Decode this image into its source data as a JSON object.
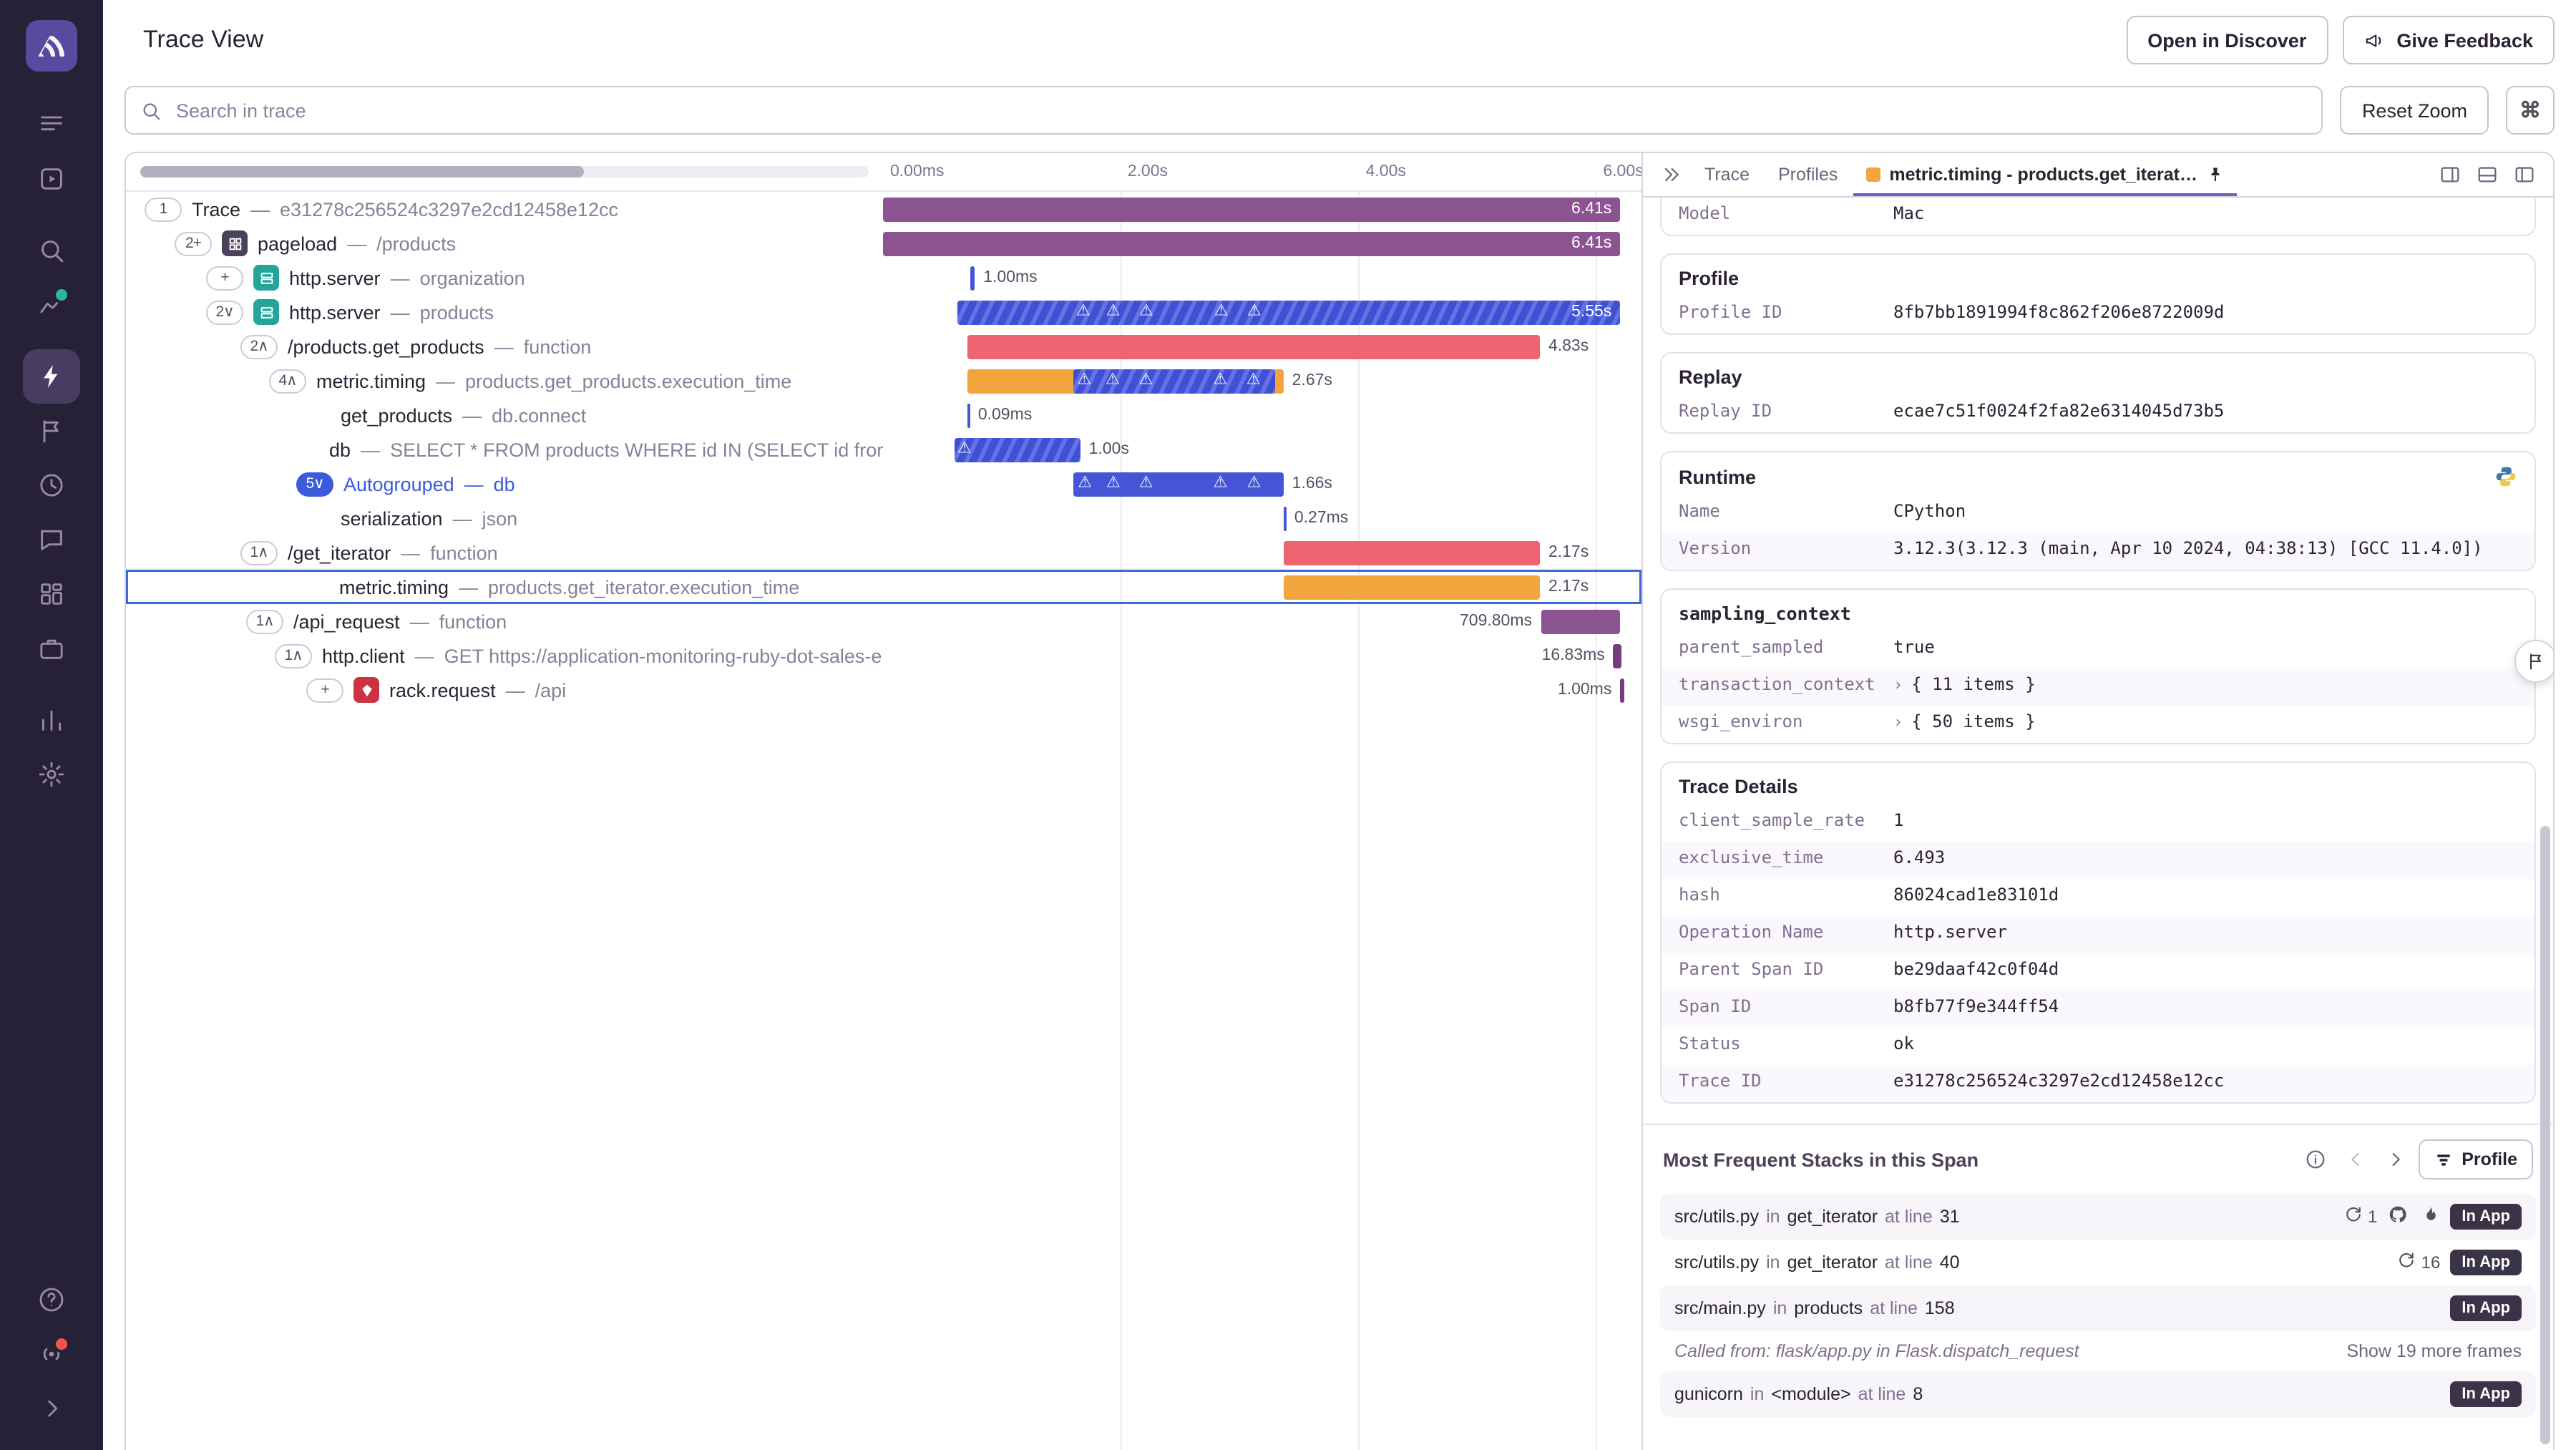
{
  "colors": {
    "accent": "#6C5FC7",
    "link": "#4a51c9",
    "number": "#3b5bdb",
    "boolean": "#c05717",
    "bar_plum": "#8c5393",
    "bar_red": "#ee6471",
    "bar_orange": "#f2a53c",
    "bar_blue": "#4456d7",
    "selected_outline": "#3b6ad8",
    "sidebar_bg": "#272138",
    "badge_bg": "#3b3449",
    "notification_teal": "#2db4a2",
    "notification_red": "#f55549"
  },
  "sidebar": {
    "main": [
      {
        "id": "issues"
      },
      {
        "id": "projects"
      },
      {
        "id": "search",
        "gap": true
      },
      {
        "id": "stats",
        "dot": "#2db4a2"
      },
      {
        "id": "performance",
        "gap": true,
        "active": true
      },
      {
        "id": "releases"
      },
      {
        "id": "crons"
      },
      {
        "id": "user-feedback"
      },
      {
        "id": "dashboards"
      },
      {
        "id": "business"
      },
      {
        "id": "metrics",
        "gap": true
      },
      {
        "id": "settings"
      }
    ],
    "bottom": [
      {
        "id": "help"
      },
      {
        "id": "whats-new",
        "dot": "#f55549"
      },
      {
        "id": "collapse"
      }
    ]
  },
  "header": {
    "title": "Trace View",
    "open_in_discover": "Open in Discover",
    "give_feedback": "Give Feedback"
  },
  "toolbar": {
    "search_placeholder": "Search in trace",
    "reset_zoom": "Reset Zoom",
    "shortcut": "⌘"
  },
  "waterfall": {
    "sep": "—",
    "axis": [
      {
        "t": "0.00ms",
        "p": 0
      },
      {
        "t": "2.00s",
        "p": 31.3
      },
      {
        "t": "4.00s",
        "p": 62.7
      },
      {
        "t": "6.00s",
        "p": 94
      }
    ],
    "mark_icon": "warning-triangle",
    "rows": [
      {
        "chip": "1",
        "ind": 13,
        "op": "Trace",
        "desc": "e31278c256524c3297e2cd12458e12cc",
        "bar": {
          "l": 0,
          "w": 97.2,
          "c": "plum",
          "dur": "6.41s",
          "mode": "inside"
        }
      },
      {
        "chip": "2+",
        "ind": 34,
        "icon": "pageload",
        "op": "pageload",
        "desc": "/products",
        "bar": {
          "l": 0,
          "w": 97.2,
          "c": "plum",
          "dur": "6.41s",
          "mode": "inside"
        }
      },
      {
        "chip": "+",
        "ind": 56,
        "icon": "http",
        "op": "http.server",
        "desc": "organization",
        "bar": {
          "l": 11.6,
          "w": 0.5,
          "c": "blue",
          "dur": "1.00ms",
          "mode": "right"
        }
      },
      {
        "chip": "2∨",
        "ind": 56,
        "icon": "http",
        "op": "http.server",
        "desc": "products",
        "bar": {
          "l": 9.8,
          "w": 87.4,
          "c": "blue-str",
          "dur": "5.55s",
          "mode": "inside",
          "marks": [
            19,
            23.5,
            28.5,
            39.8,
            44.8
          ]
        }
      },
      {
        "chip": "2∧",
        "ind": 80,
        "op": "/products.get_products",
        "desc": "function",
        "bar": {
          "l": 11.1,
          "w": 75.5,
          "c": "red",
          "dur": "4.83s",
          "mode": "right"
        }
      },
      {
        "chip": "4∧",
        "ind": 100,
        "op": "metric.timing",
        "desc": "products.get_products.execution_time",
        "bar": {
          "l": 11.1,
          "w": 41.7,
          "c": "orange",
          "dur": "2.67s",
          "mode": "right",
          "overlay": {
            "l": 33.5,
            "w": 64
          },
          "marks": [
            37,
            46,
            56.5,
            80,
            90.5
          ]
        }
      },
      {
        "ind": 150,
        "op": "get_products",
        "desc": "db.connect",
        "bar": {
          "l": 11.1,
          "w": 0.3,
          "c": "blue",
          "dur": "0.09ms",
          "mode": "right"
        }
      },
      {
        "ind": 142,
        "op": "db",
        "desc": "SELECT * FROM products WHERE id IN (SELECT id from produ",
        "bar": {
          "l": 9.4,
          "w": 16.6,
          "c": "blue-str",
          "dur": "1.00s",
          "mode": "right",
          "marks": [
            8
          ]
        }
      },
      {
        "chip": "5∨",
        "chipKind": "blue",
        "ind": 119,
        "op": "Autogrouped",
        "desc": "db",
        "blue": true,
        "bar": {
          "l": 25.1,
          "w": 27.7,
          "c": "blue",
          "dur": "1.66s",
          "mode": "right",
          "marks": [
            5.5,
            19,
            34.6,
            70,
            86
          ]
        }
      },
      {
        "ind": 150,
        "op": "serialization",
        "desc": "json",
        "bar": {
          "l": 52.8,
          "w": 0.3,
          "c": "blue",
          "dur": "0.27ms",
          "mode": "right"
        }
      },
      {
        "chip": "1∧",
        "ind": 80,
        "op": "/get_iterator",
        "desc": "function",
        "bar": {
          "l": 52.8,
          "w": 33.8,
          "c": "red",
          "dur": "2.17s",
          "mode": "right"
        }
      },
      {
        "ind": 149,
        "selected": true,
        "op": "metric.timing",
        "desc": "products.get_iterator.execution_time",
        "bar": {
          "l": 52.8,
          "w": 33.8,
          "c": "orange",
          "dur": "2.17s",
          "mode": "right"
        }
      },
      {
        "chip": "1∧",
        "ind": 84,
        "op": "/api_request",
        "desc": "function",
        "bar": {
          "l": 86.7,
          "w": 10.5,
          "c": "plum",
          "dur": "709.80ms",
          "mode": "left"
        }
      },
      {
        "chip": "1∧",
        "ind": 104,
        "op": "http.client",
        "desc": "GET https://application-monitoring-ruby-dot-sales-eng",
        "bar": {
          "l": 96.3,
          "w": 1,
          "c": "darkplum",
          "dur": "16.83ms",
          "mode": "left"
        }
      },
      {
        "chip": "+",
        "ind": 126,
        "icon": "ruby",
        "op": "rack.request",
        "desc": "/api",
        "bar": {
          "l": 97.2,
          "w": 0.5,
          "c": "darkplum",
          "dur": "1.00ms",
          "mode": "left"
        }
      }
    ]
  },
  "detail": {
    "tabs": [
      {
        "label": "Trace"
      },
      {
        "label": "Profiles"
      }
    ],
    "active_tab": {
      "label": "metric.timing - products.get_iterat…"
    },
    "cards": [
      {
        "cut": true,
        "rows": [
          {
            "k": "Model",
            "v": "Mac"
          }
        ]
      },
      {
        "title": "Profile",
        "rows": [
          {
            "k": "Profile ID",
            "v": "8fb7bb1891994f8c862f206e8722009d",
            "type": "link"
          }
        ]
      },
      {
        "title": "Replay",
        "rows": [
          {
            "k": "Replay ID",
            "v": "ecae7c51f0024f2fa82e6314045d73b5",
            "type": "link"
          }
        ]
      },
      {
        "title": "Runtime",
        "icon": "python",
        "rows": [
          {
            "k": "Name",
            "v": "CPython"
          },
          {
            "k": "Version",
            "v": "3.12.3(3.12.3 (main, Apr 10 2024, 04:38:13) [GCC 11.4.0])"
          }
        ]
      },
      {
        "title": "sampling_context",
        "mono": true,
        "rows": [
          {
            "k": "parent_sampled",
            "v": "true",
            "type": "bool"
          },
          {
            "k": "transaction_context",
            "v": "{ 11 items }",
            "expand": true
          },
          {
            "k": "wsgi_environ",
            "v": "{ 50 items }",
            "expand": true
          }
        ]
      },
      {
        "title": "Trace Details",
        "rows": [
          {
            "k": "client_sample_rate",
            "v": "1",
            "type": "num"
          },
          {
            "k": "exclusive_time",
            "v": "6.493",
            "type": "num"
          },
          {
            "k": "hash",
            "v": "86024cad1e83101d"
          },
          {
            "k": "Operation Name",
            "v": "http.server"
          },
          {
            "k": "Parent Span ID",
            "v": "be29daaf42c0f04d"
          },
          {
            "k": "Span ID",
            "v": "b8fb77f9e344ff54"
          },
          {
            "k": "Status",
            "v": "ok"
          },
          {
            "k": "Trace ID",
            "v": "e31278c256524c3297e2cd12458e12cc",
            "type": "link"
          }
        ]
      }
    ],
    "stacks": {
      "title": "Most Frequent Stacks in this Span",
      "profile_button": "Profile",
      "words": {
        "in": "in",
        "at": "at line"
      },
      "rows": [
        {
          "file": "src/utils.py",
          "fn": "get_iterator",
          "line": "31",
          "count": "1",
          "gh": true,
          "flame": true,
          "badge": "In App"
        },
        {
          "file": "src/utils.py",
          "fn": "get_iterator",
          "line": "40",
          "count": "16",
          "badge": "In App"
        },
        {
          "file": "src/main.py",
          "fn": "products",
          "line": "158",
          "badge": "In App"
        },
        {
          "called": "Called from: flask/app.py in Flask.dispatch_request",
          "more": "Show 19 more frames"
        },
        {
          "file": "gunicorn",
          "fn": "<module>",
          "line": "8",
          "badge": "In App"
        }
      ]
    }
  }
}
